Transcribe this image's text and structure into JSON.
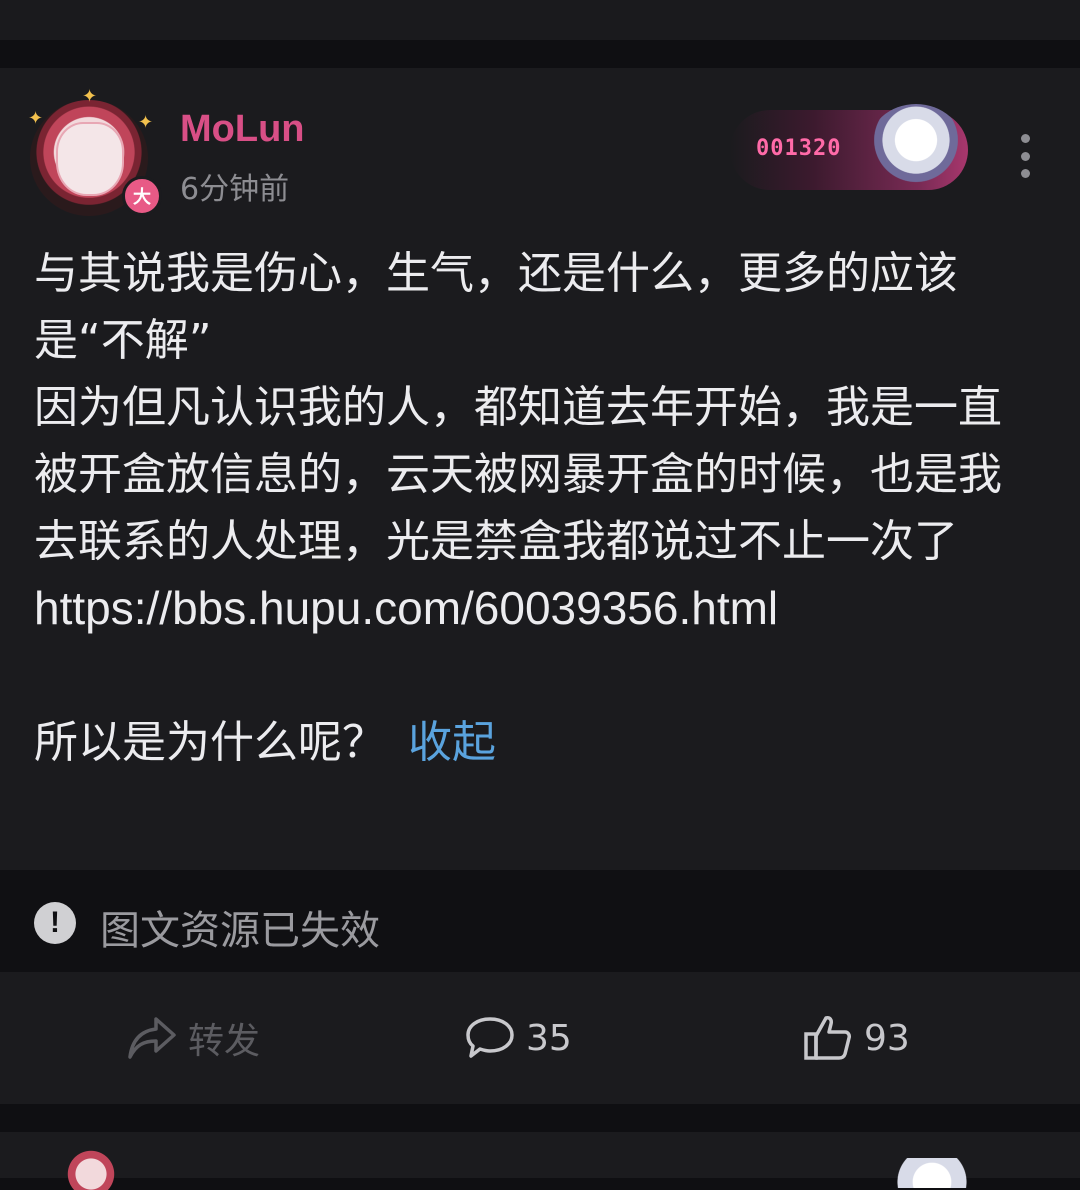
{
  "post": {
    "username": "MoLun",
    "timestamp": "6分钟前",
    "avatar_badge": "大",
    "fan_badge_number": "001320",
    "paragraphs": [
      "与其说我是伤心，生气，还是什么，更多的应该是“不解”",
      "因为但凡认识我的人，都知道去年开始，我是一直被开盒放信息的，云天被网暴开盒的时候，也是我去联系的人处理，光是禁盒我都说过不止一次了"
    ],
    "link": "https://bbs.hupu.com/60039356.html",
    "question": "所以是为什么呢？",
    "collapse_label": "收起"
  },
  "notice": {
    "icon": "exclamation-icon",
    "text": "图文资源已失效"
  },
  "actions": {
    "repost_label": "转发",
    "comment_count": "35",
    "like_count": "93"
  },
  "colors": {
    "username": "#d84f86",
    "link_accent": "#5aa3de",
    "background": "#1b1b1e"
  }
}
